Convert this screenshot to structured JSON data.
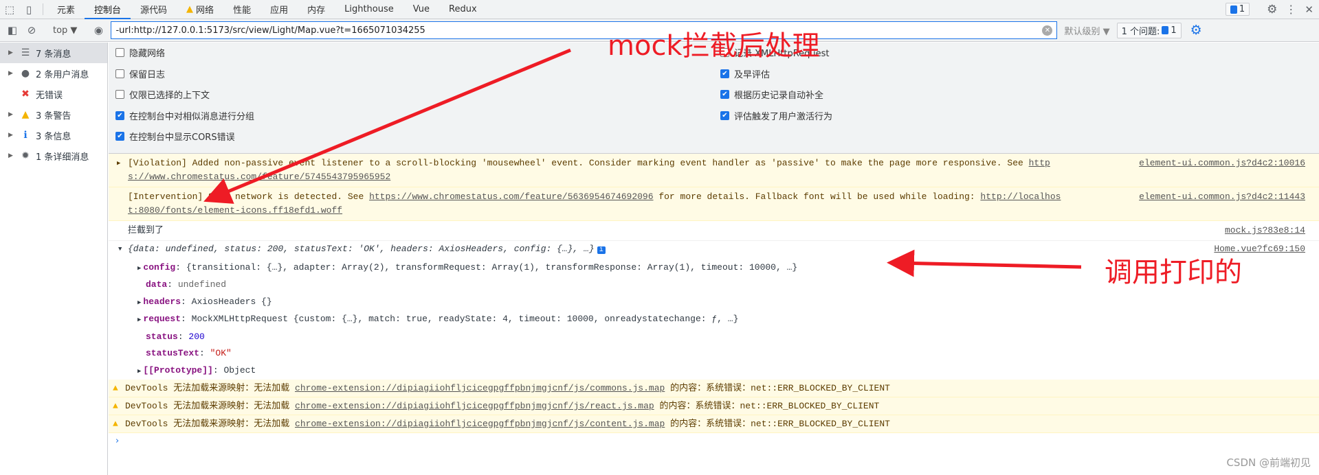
{
  "tabs": [
    "元素",
    "控制台",
    "源代码",
    "网络",
    "性能",
    "应用",
    "内存",
    "Lighthouse",
    "Vue",
    "Redux"
  ],
  "active_tab": "控制台",
  "issues_badge": "1",
  "toolbar": {
    "context": "top ▼",
    "filter_value": "-url:http://127.0.0.1:5173/src/view/Light/Map.vue?t=1665071034255",
    "levels": "默认级别 ▼",
    "issues_label": "1 个问题:",
    "issues_count": "1"
  },
  "sidebar": [
    {
      "label": "7 条消息",
      "icon": "list-icon"
    },
    {
      "label": "2 条用户消息",
      "icon": "user-icon"
    },
    {
      "label": "无错误",
      "icon": "error-icon"
    },
    {
      "label": "3 条警告",
      "icon": "warning-icon"
    },
    {
      "label": "3 条信息",
      "icon": "info-icon"
    },
    {
      "label": "1 条详细消息",
      "icon": "bug-icon"
    }
  ],
  "settings_left": [
    {
      "label": "隐藏网络",
      "checked": false
    },
    {
      "label": "保留日志",
      "checked": false
    },
    {
      "label": "仅限已选择的上下文",
      "checked": false
    },
    {
      "label": "在控制台中对相似消息进行分组",
      "checked": true
    },
    {
      "label": "在控制台中显示CORS错误",
      "checked": true
    }
  ],
  "settings_right": [
    {
      "label": "记录 XMLHttpRequest",
      "checked": false
    },
    {
      "label": "及早评估",
      "checked": true
    },
    {
      "label": "根据历史记录自动补全",
      "checked": true
    },
    {
      "label": "评估触发了用户激活行为",
      "checked": true
    }
  ],
  "messages": {
    "violation": {
      "text": "[Violation] Added non-passive event listener to a scroll-blocking 'mousewheel' event. Consider marking event handler as 'passive' to make the page more responsive. See ",
      "link": "https://www.chromestatus.com/feature/5745543795965952",
      "link_a": "http",
      "link_b": "s://www.chromestatus.com/feature/5745543795965952",
      "source": "element-ui.common.js?d4c2:10016"
    },
    "intervention": {
      "text": "[Intervention] Slow network is detected. See ",
      "link": "https://www.chromestatus.com/feature/5636954674692096",
      "mid": " for more details. Fallback font will be used while loading: ",
      "link2_a": "http://localhos",
      "link2_b": "t:8080/fonts/element-icons.ff18efd1.woff",
      "source": "element-ui.common.js?d4c2:11443"
    },
    "log": {
      "text": "拦截到了",
      "source": "mock.js?83e8:14"
    },
    "object": {
      "source": "Home.vue?fc69:150",
      "summary": "{data: undefined, status: 200, statusText: 'OK', headers: AxiosHeaders, config: {…}, …}",
      "props": [
        {
          "key": "config",
          "value": "{transitional: {…}, adapter: Array(2), transformRequest: Array(1), transformResponse: Array(1), timeout: 10000, …}",
          "expandable": true
        },
        {
          "key": "data",
          "value": "undefined",
          "expandable": false
        },
        {
          "key": "headers",
          "value": "AxiosHeaders {}",
          "expandable": true
        },
        {
          "key": "request",
          "value": "MockXMLHttpRequest {custom: {…}, match: true, readyState: 4, timeout: 10000, onreadystatechange: ƒ, …}",
          "expandable": true
        },
        {
          "key": "status",
          "value": "200",
          "expandable": false
        },
        {
          "key": "statusText",
          "value": "\"OK\"",
          "expandable": false
        },
        {
          "key": "[[Prototype]]",
          "value": "Object",
          "expandable": true
        }
      ]
    },
    "warnings": [
      {
        "prefix": "DevTools 无法加载来源映射：无法加载 ",
        "link": "chrome-extension://dipiagiiohfljcicegpgffpbnjmgjcnf/js/commons.js.map",
        "suffix": " 的内容：系统错误：net::ERR_BLOCKED_BY_CLIENT"
      },
      {
        "prefix": "DevTools 无法加载来源映射：无法加载 ",
        "link": "chrome-extension://dipiagiiohfljcicegpgffpbnjmgjcnf/js/react.js.map",
        "suffix": " 的内容：系统错误：net::ERR_BLOCKED_BY_CLIENT"
      },
      {
        "prefix": "DevTools 无法加载来源映射：无法加载 ",
        "link": "chrome-extension://dipiagiiohfljcicegpgffpbnjmgjcnf/js/content.js.map",
        "suffix": " 的内容：系统错误：net::ERR_BLOCKED_BY_CLIENT"
      }
    ]
  },
  "annotations": {
    "top": "mock拦截后处理",
    "right": "调用打印的",
    "color": "#ee1c25"
  },
  "watermark": "CSDN @前端初见"
}
